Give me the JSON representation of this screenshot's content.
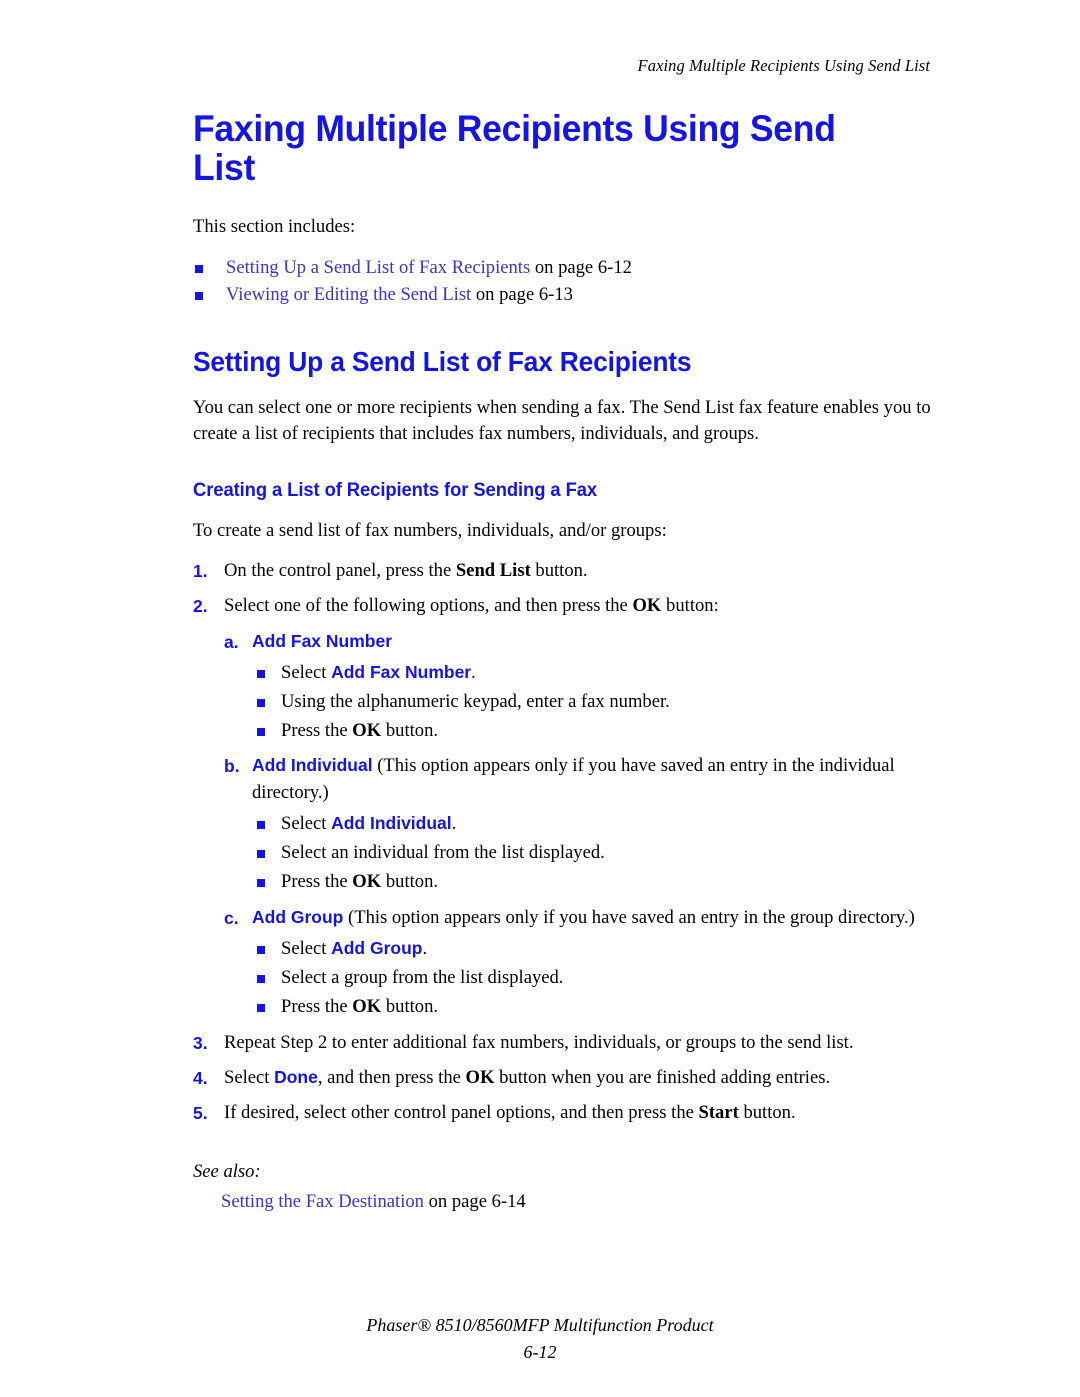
{
  "page": {
    "running_header": "Faxing Multiple Recipients Using Send List",
    "title": "Faxing Multiple Recipients Using Send List",
    "intro": "This section includes:"
  },
  "toc": {
    "items": [
      {
        "link": "Setting Up a Send List of Fax Recipients",
        "suffix": " on page 6-12"
      },
      {
        "link": "Viewing or Editing the Send List",
        "suffix": " on page 6-13"
      }
    ]
  },
  "section": {
    "heading": "Setting Up a Send List of Fax Recipients",
    "paragraph": "You can select one or more recipients when sending a fax. The Send List fax feature enables you to create a list of recipients that includes fax numbers, individuals, and groups.",
    "subheading": "Creating a List of Recipients for Sending a Fax",
    "lead": "To create a send list of fax numbers, individuals, and/or groups:"
  },
  "steps": {
    "step1": {
      "num": "1.",
      "pre": "On the control panel, press the ",
      "term": "Send List",
      "post": " button."
    },
    "step2": {
      "num": "2.",
      "pre": "Select one of the following options, and then press the ",
      "term": "OK",
      "post": " button:"
    },
    "step3": {
      "num": "3.",
      "text": "Repeat Step 2 to enter additional fax numbers, individuals, or groups to the send list."
    },
    "step4": {
      "num": "4.",
      "pre": "Select ",
      "ui_term": "Done",
      "mid": ", and then press the ",
      "bold_term": "OK",
      "post": " button when you are finished adding entries."
    },
    "step5": {
      "num": "5.",
      "pre": "If desired, select other control panel options, and then press the ",
      "term": "Start",
      "post": " button."
    }
  },
  "options": [
    {
      "letter": "a.",
      "label": "Add Fax Number",
      "note": "",
      "bullets": [
        {
          "pre": "Select ",
          "ui_term": "Add Fax Number",
          "post": "."
        },
        {
          "pre": "Using the alphanumeric keypad, enter a fax number.",
          "ui_term": "",
          "post": ""
        },
        {
          "pre": "Press the ",
          "bold_term": "OK",
          "post": " button."
        }
      ]
    },
    {
      "letter": "b.",
      "label": "Add Individual",
      "note": " (This option appears only if you have saved an entry in the individual directory.)",
      "bullets": [
        {
          "pre": "Select ",
          "ui_term": "Add Individual",
          "post": "."
        },
        {
          "pre": "Select an individual from the list displayed.",
          "ui_term": "",
          "post": ""
        },
        {
          "pre": "Press the ",
          "bold_term": "OK",
          "post": " button."
        }
      ]
    },
    {
      "letter": "c.",
      "label": "Add Group",
      "note": " (This option appears only if you have saved an entry in the group directory.)",
      "bullets": [
        {
          "pre": "Select ",
          "ui_term": "Add Group",
          "post": "."
        },
        {
          "pre": "Select a group from the list displayed.",
          "ui_term": "",
          "post": ""
        },
        {
          "pre": "Press the ",
          "bold_term": "OK",
          "post": " button."
        }
      ]
    }
  ],
  "see_also": {
    "label": "See also:",
    "link": "Setting the Fax Destination",
    "suffix": " on page 6-14"
  },
  "footer": {
    "product": "Phaser® 8510/8560MFP Multifunction Product",
    "page_number": "6-12"
  },
  "colors": {
    "heading_blue": "#1414E6",
    "link_blue": "#3A34CC",
    "text_black": "#000000"
  }
}
